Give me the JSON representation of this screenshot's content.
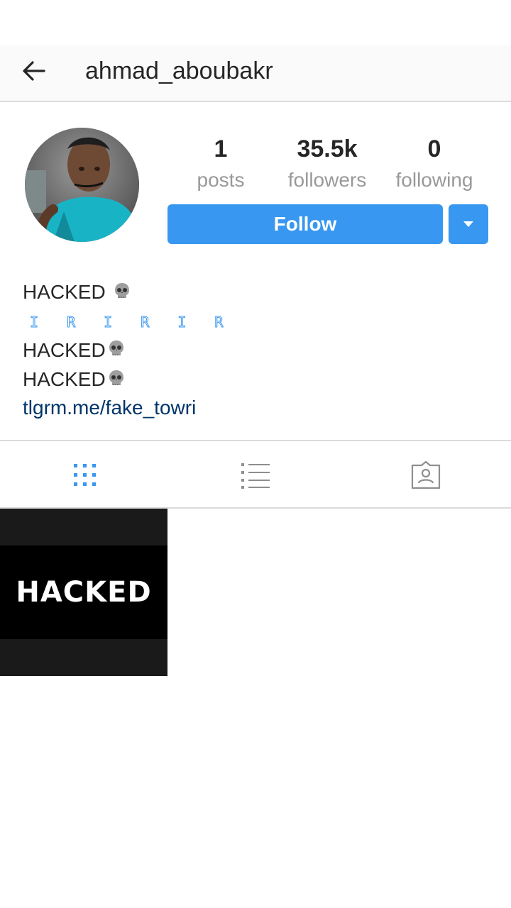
{
  "header": {
    "username": "ahmad_aboubakr"
  },
  "stats": {
    "posts_count": "1",
    "posts_label": "posts",
    "followers_count": "35.5k",
    "followers_label": "followers",
    "following_count": "0",
    "following_label": "following"
  },
  "actions": {
    "follow_label": "Follow"
  },
  "bio": {
    "line1": "HACKED",
    "pattern": "I R I R I R",
    "line2": "HACKED",
    "line3": "HACKED",
    "link": "tlgrm.me/fake_towri"
  },
  "tabs": {
    "active": "grid",
    "icons": [
      "grid-icon",
      "list-icon",
      "tagged-icon"
    ]
  },
  "posts": [
    {
      "caption_text": "HACKED"
    }
  ],
  "colors": {
    "accent": "#3897f0",
    "link": "#003569",
    "muted": "#999999",
    "divider": "#dbdbdb"
  }
}
